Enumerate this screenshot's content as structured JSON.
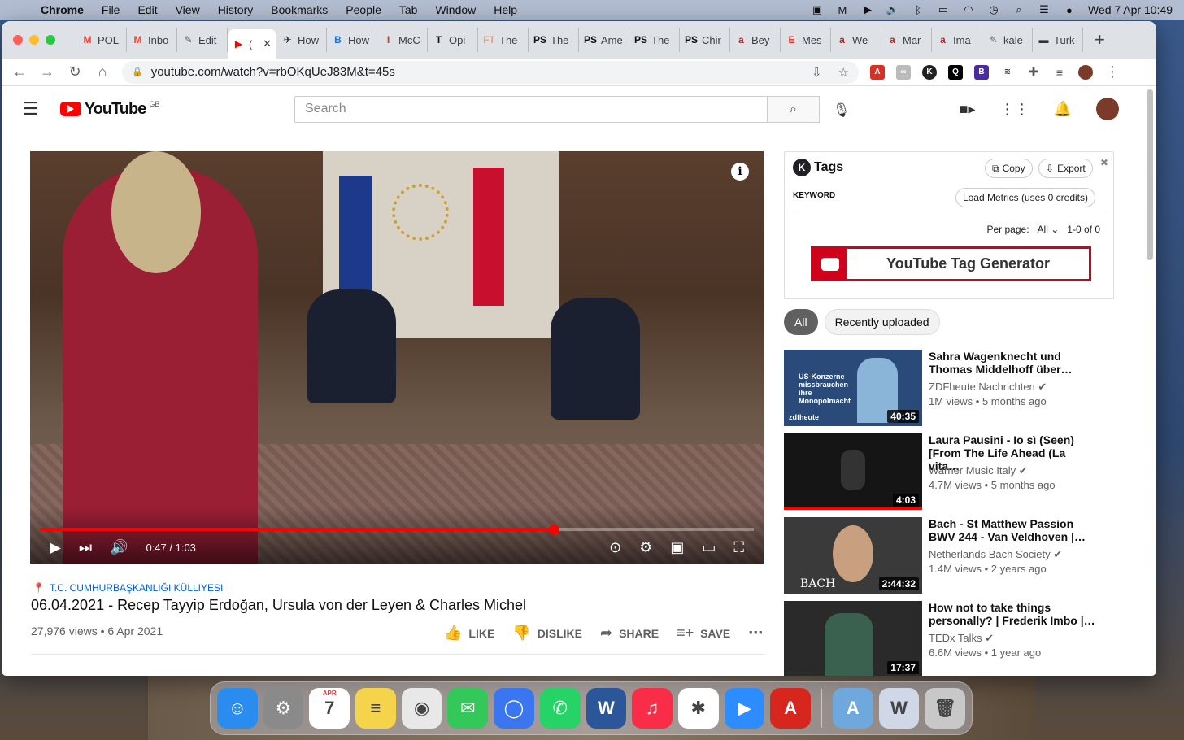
{
  "menubar": {
    "app": "Chrome",
    "items": [
      "File",
      "Edit",
      "View",
      "History",
      "Bookmarks",
      "People",
      "Tab",
      "Window",
      "Help"
    ],
    "datetime": "Wed 7 Apr  10:49"
  },
  "tabs": [
    {
      "label": "POL",
      "fav": "M",
      "color": "#ea4335"
    },
    {
      "label": "Inbo",
      "fav": "M",
      "color": "#ea4335"
    },
    {
      "label": "Edit",
      "fav": "✎",
      "color": "#5f6368"
    },
    {
      "label": "(",
      "fav": "▶",
      "color": "#ff0000"
    },
    {
      "label": "How",
      "fav": "✈",
      "color": "#333333"
    },
    {
      "label": "How",
      "fav": "B",
      "color": "#1a73e8"
    },
    {
      "label": "McC",
      "fav": "I",
      "color": "#d93025"
    },
    {
      "label": "Opi",
      "fav": "T",
      "color": "#111111"
    },
    {
      "label": "The",
      "fav": "FT",
      "color": "#e9a07a"
    },
    {
      "label": "The",
      "fav": "PS",
      "color": "#111111"
    },
    {
      "label": "Ame",
      "fav": "PS",
      "color": "#111111"
    },
    {
      "label": "The",
      "fav": "PS",
      "color": "#111111"
    },
    {
      "label": "Chir",
      "fav": "PS",
      "color": "#111111"
    },
    {
      "label": "Bey",
      "fav": "a",
      "color": "#c5221f"
    },
    {
      "label": "Mes",
      "fav": "E",
      "color": "#d93025"
    },
    {
      "label": "We",
      "fav": "a",
      "color": "#c5221f"
    },
    {
      "label": "Mar",
      "fav": "a",
      "color": "#c5221f"
    },
    {
      "label": "Ima",
      "fav": "a",
      "color": "#c5221f"
    },
    {
      "label": "kale",
      "fav": "✎",
      "color": "#5f6368"
    },
    {
      "label": "Turk",
      "fav": "▬",
      "color": "#333333"
    }
  ],
  "omnibox": {
    "url": "youtube.com/watch?v=rbOKqUeJ83M&t=45s"
  },
  "yt": {
    "logo": "YouTube",
    "region": "GB",
    "search_placeholder": "Search"
  },
  "player": {
    "time": "0:47 / 1:03",
    "progress": 0.72
  },
  "video": {
    "location": "T.C. CUMHURBAŞKANLIĞI KÜLLIYESI",
    "title": "06.04.2021 - Recep Tayyip Erdoğan, Ursula von der Leyen & Charles Michel",
    "stats": "27,976 views • 6 Apr 2021",
    "like": "LIKE",
    "dislike": "DISLIKE",
    "share": "SHARE",
    "save": "SAVE"
  },
  "tags_panel": {
    "title": "Tags",
    "copy": "Copy",
    "export": "Export",
    "keyword": "KEYWORD",
    "load": "Load Metrics (uses 0 credits)",
    "per_page_label": "Per page:",
    "per_page_value": "All",
    "range": "1-0 of 0",
    "generator": "YouTube Tag Generator"
  },
  "chips": [
    "All",
    "Recently uploaded"
  ],
  "related": [
    {
      "title": "Sahra Wagenknecht und Thomas Middelhoff über…",
      "channel": "ZDFheute Nachrichten",
      "meta": "1M views • 5 months ago",
      "duration": "40:35",
      "bg": "#2a4a7a"
    },
    {
      "title": "Laura Pausini - Io sì (Seen) [From The Life Ahead (La vita…",
      "channel": "Warner Music Italy",
      "meta": "4.7M views • 5 months ago",
      "duration": "4:03",
      "bg": "#151515"
    },
    {
      "title": "Bach - St Matthew Passion BWV 244 - Van Veldhoven |…",
      "channel": "Netherlands Bach Society",
      "meta": "1.4M views • 2 years ago",
      "duration": "2:44:32",
      "bg": "#3a3a3a"
    },
    {
      "title": "How not to take things personally? | Frederik Imbo |…",
      "channel": "TEDx Talks",
      "meta": "6.6M views • 1 year ago",
      "duration": "17:37",
      "bg": "#2a2a2a"
    }
  ],
  "thumb_text": {
    "zdf_overlay": "US-Konzerne missbrauchen ihre Monopolmacht",
    "zdf_brand": "zdfheute",
    "bach": "BACH"
  },
  "dock": [
    {
      "name": "finder",
      "color": "#2b8cf0",
      "glyph": "☺"
    },
    {
      "name": "system-preferences",
      "color": "#8a8a8a",
      "glyph": "⚙"
    },
    {
      "name": "calendar",
      "color": "#ffffff",
      "glyph": "7"
    },
    {
      "name": "notes",
      "color": "#f5d34a",
      "glyph": "≡"
    },
    {
      "name": "chrome",
      "color": "#e8e8e8",
      "glyph": "◉"
    },
    {
      "name": "messages",
      "color": "#34c759",
      "glyph": "✉"
    },
    {
      "name": "signal",
      "color": "#3a76f0",
      "glyph": "◯"
    },
    {
      "name": "whatsapp",
      "color": "#25d366",
      "glyph": "✆"
    },
    {
      "name": "word",
      "color": "#2b579a",
      "glyph": "W"
    },
    {
      "name": "music",
      "color": "#fa2d48",
      "glyph": "♫"
    },
    {
      "name": "slack",
      "color": "#ffffff",
      "glyph": "✱"
    },
    {
      "name": "zoom",
      "color": "#2d8cff",
      "glyph": "▶"
    },
    {
      "name": "acrobat",
      "color": "#d7261e",
      "glyph": "A"
    }
  ],
  "dock_right": [
    {
      "name": "applications-folder",
      "color": "#6fa8dc",
      "glyph": "A"
    },
    {
      "name": "documents",
      "color": "#d0d8e8",
      "glyph": "W"
    },
    {
      "name": "trash",
      "color": "#c8c8c8",
      "glyph": "🗑"
    }
  ],
  "calendar_month": "APR",
  "colors": {
    "yt_red": "#ff0000",
    "link_blue": "#065fd4"
  }
}
